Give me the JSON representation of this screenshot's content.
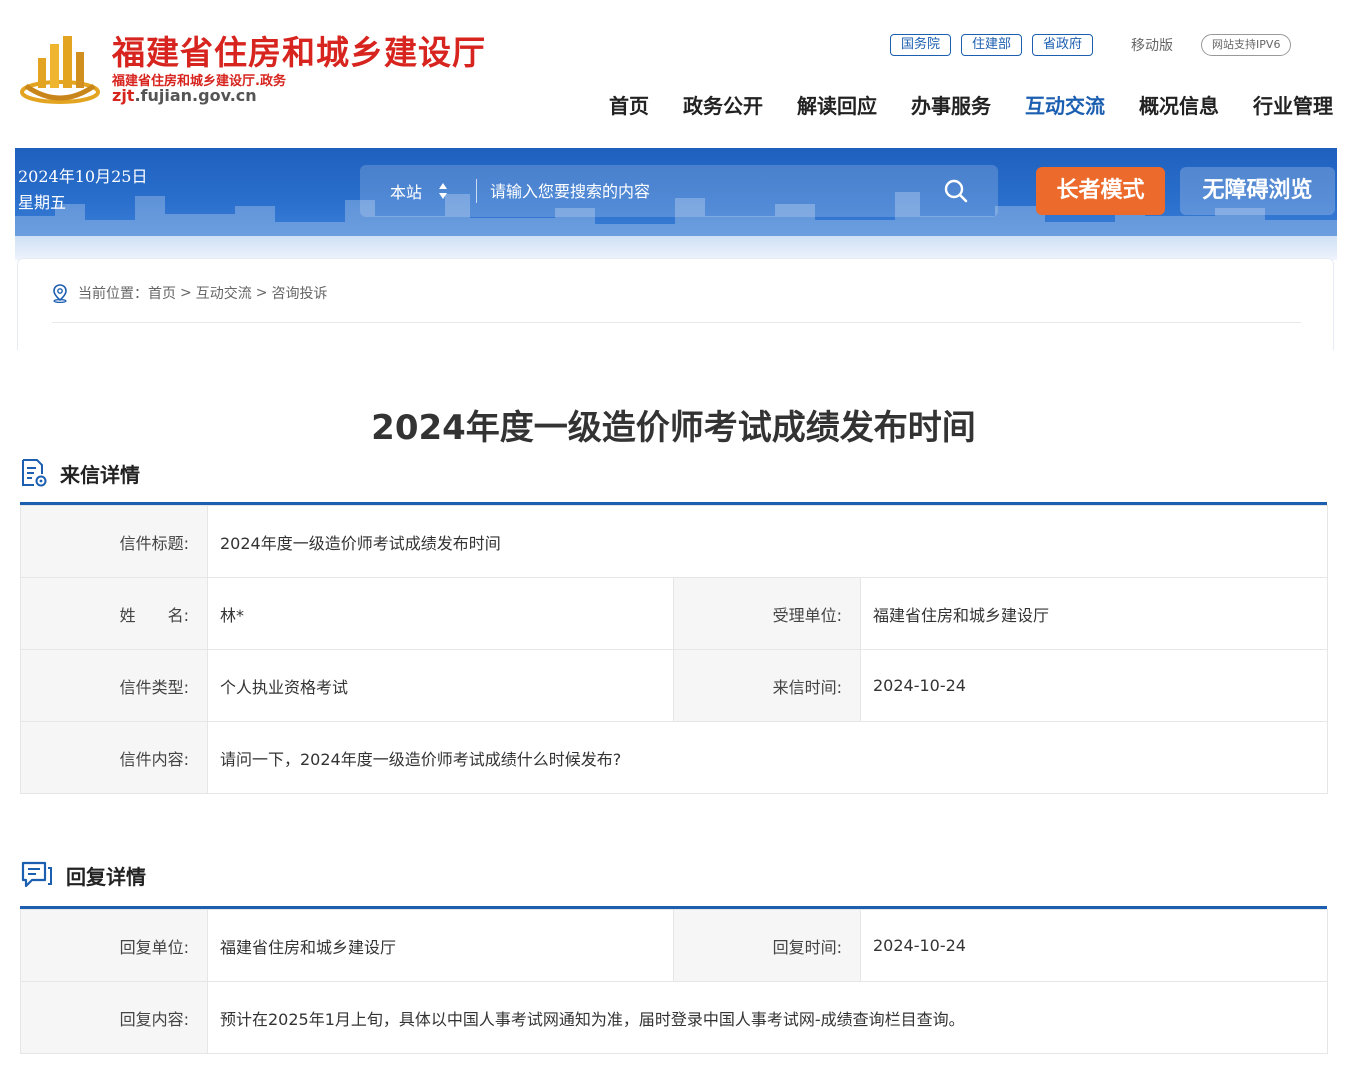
{
  "header": {
    "site_title": "福建省住房和城乡建设厅",
    "site_subtitle": "福建省住房和城乡建设厅.政务",
    "domain_prefix": "zjt",
    "domain_rest": ".fujian.gov.cn",
    "top_links": [
      "国务院",
      "住建部",
      "省政府"
    ],
    "mobile_label": "移动版",
    "ipv6_label": "网站支持IPV6",
    "nav": [
      "首页",
      "政务公开",
      "解读回应",
      "办事服务",
      "互动交流",
      "概况信息",
      "行业管理"
    ],
    "active_nav": "互动交流"
  },
  "banner": {
    "date": "2024年10月25日",
    "weekday": "星期五",
    "search_scope": "本站",
    "search_placeholder": "请输入您要搜索的内容",
    "elder_mode": "长者模式",
    "accessibility": "无障碍浏览"
  },
  "breadcrumb": {
    "prefix": "当前位置：",
    "items": [
      "首页",
      "互动交流",
      "咨询投诉"
    ],
    "separator": ">"
  },
  "title": "2024年度一级造价师考试成绩发布时间",
  "letter": {
    "section_label": "来信详情",
    "subject_label": "信件标题:",
    "subject": "2024年度一级造价师考试成绩发布时间",
    "name_label": "姓　　名:",
    "name": "林*",
    "dept_label": "受理单位:",
    "dept": "福建省住房和城乡建设厅",
    "type_label": "信件类型:",
    "type": "个人执业资格考试",
    "time_label": "来信时间:",
    "time": "2024-10-24",
    "content_label": "信件内容:",
    "content": "请问一下，2024年度一级造价师考试成绩什么时候发布?"
  },
  "reply": {
    "section_label": "回复详情",
    "unit_label": "回复单位:",
    "unit": "福建省住房和城乡建设厅",
    "time_label": "回复时间:",
    "time": "2024-10-24",
    "content_label": "回复内容:",
    "content": "预计在2025年1月上旬，具体以中国人事考试网通知为准，届时登录中国人事考试网-成绩查询栏目查询。"
  },
  "colors": {
    "brand_red": "#d7241e",
    "brand_blue": "#1c5fb1",
    "elder_orange": "#ec6a2b"
  }
}
